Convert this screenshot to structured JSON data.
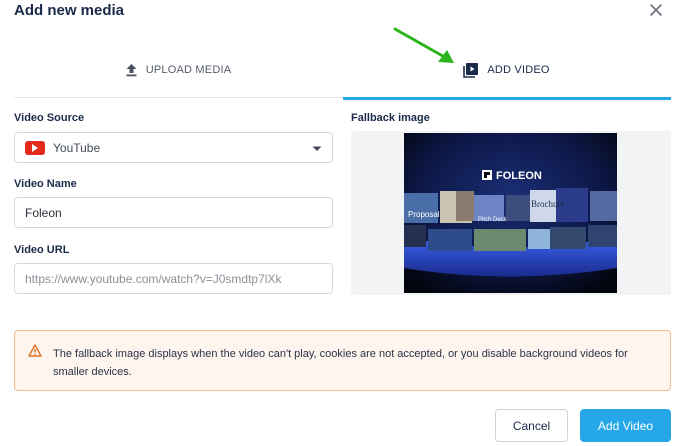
{
  "dialog": {
    "title": "Add new media"
  },
  "tabs": [
    {
      "label": "UPLOAD MEDIA",
      "icon": "upload-icon",
      "active": false
    },
    {
      "label": "ADD VIDEO",
      "icon": "video-icon",
      "active": true
    }
  ],
  "form": {
    "video_source": {
      "label": "Video Source",
      "value": "YouTube",
      "icon": "youtube-icon"
    },
    "video_name": {
      "label": "Video Name",
      "value": "Foleon"
    },
    "video_url": {
      "label": "Video URL",
      "placeholder": "https://www.youtube.com/watch?v=J0smdtp7lXk"
    }
  },
  "fallback": {
    "label": "Fallback image",
    "thumbnail": {
      "brand": "FOLEON",
      "cards": [
        "Proposal",
        "Pitch Deck",
        "Brochure"
      ]
    }
  },
  "notice": {
    "icon": "warning-icon",
    "text": "The fallback image displays when the video can't play, cookies are not accepted, or you disable background videos for smaller devices."
  },
  "actions": {
    "cancel": "Cancel",
    "add": "Add Video"
  },
  "colors": {
    "accent": "#25a7ea",
    "title": "#1b2a4a",
    "warning_border": "#f5b98a",
    "warning_bg": "#fdf5ee",
    "youtube": "#e42a1d",
    "annotation_arrow": "#2bb41c"
  }
}
